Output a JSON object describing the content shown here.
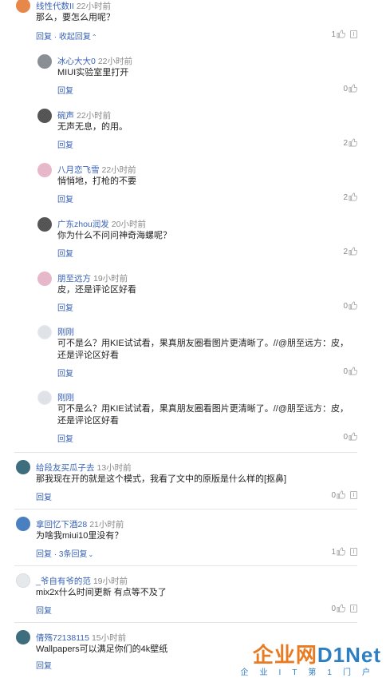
{
  "comments": [
    {
      "user": "线性代数II",
      "time": "22小时前",
      "text": "那么，要怎么用呢？",
      "reply": "回复",
      "extra": "收起回复",
      "likes": "1"
    },
    {
      "user": "冰心大大0",
      "time": "22小时前",
      "text": "MIUI实验室里打开",
      "reply": "回复",
      "likes": "0"
    },
    {
      "user": "碗声",
      "time": "22小时前",
      "text": "无声无息，的用。",
      "reply": "回复",
      "likes": "2"
    },
    {
      "user": "八月恋飞雪",
      "time": "22小时前",
      "text": "悄悄地，打枪的不要",
      "reply": "回复",
      "likes": "2"
    },
    {
      "user": "广东zhou润发",
      "time": "20小时前",
      "text": "你为什么不问问神奇海螺呢？",
      "reply": "回复",
      "likes": "2"
    },
    {
      "user": "朋至远方",
      "time": "19小时前",
      "text": "皮，还是评论区好看",
      "reply": "回复",
      "likes": "0"
    },
    {
      "user": "刚刚",
      "time": "",
      "text": "可不是么？用KIE试试看，果真朋友圈看图片更清晰了。//@朋至远方：皮，还是评论区好看",
      "reply": "回复",
      "likes": "0"
    },
    {
      "user": "刚刚",
      "time": "",
      "text": "可不是么？用KIE试试看，果真朋友圈看图片更清晰了。//@朋至远方：皮，还是评论区好看",
      "reply": "回复",
      "likes": "0"
    },
    {
      "user": "给段友买瓜子去",
      "time": "13小时前",
      "text": "那我现在开的就是这个模式，我看了文中的原版是什么样的[抠鼻]",
      "reply": "回复",
      "likes": "0"
    },
    {
      "user": "拿回忆下酒28",
      "time": "21小时前",
      "text": "为啥我miui10里没有？",
      "reply": "回复",
      "extra": "3条回复",
      "likes": "1"
    },
    {
      "user": "_爷自有爷的范",
      "time": "19小时前",
      "text": "mix2x什么时间更新 有点等不及了",
      "reply": "回复",
      "likes": "0"
    },
    {
      "user": "倩殇72138115",
      "time": "15小时前",
      "text": "Wallpapers可以满足你们的4k壁纸",
      "reply": "回复"
    }
  ],
  "watermark": {
    "main_a": "企业网",
    "main_b": "D1Net",
    "sub": "企业IT第1门户"
  },
  "icons": {
    "like": "thumbs-up-icon",
    "report": "report-icon",
    "expand": "chevron-icon"
  }
}
